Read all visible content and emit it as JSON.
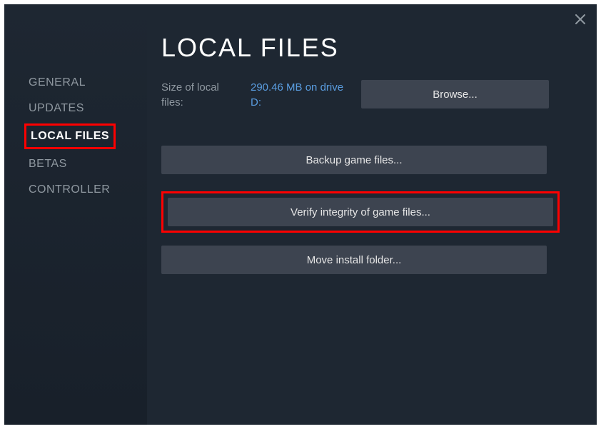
{
  "sidebar": {
    "items": [
      {
        "label": "GENERAL"
      },
      {
        "label": "UPDATES"
      },
      {
        "label": "LOCAL FILES"
      },
      {
        "label": "BETAS"
      },
      {
        "label": "CONTROLLER"
      }
    ]
  },
  "main": {
    "title": "LOCAL FILES",
    "size_label": "Size of local files:",
    "size_value": "290.46 MB on drive D:",
    "browse_label": "Browse...",
    "backup_label": "Backup game files...",
    "verify_label": "Verify integrity of game files...",
    "move_label": "Move install folder..."
  }
}
